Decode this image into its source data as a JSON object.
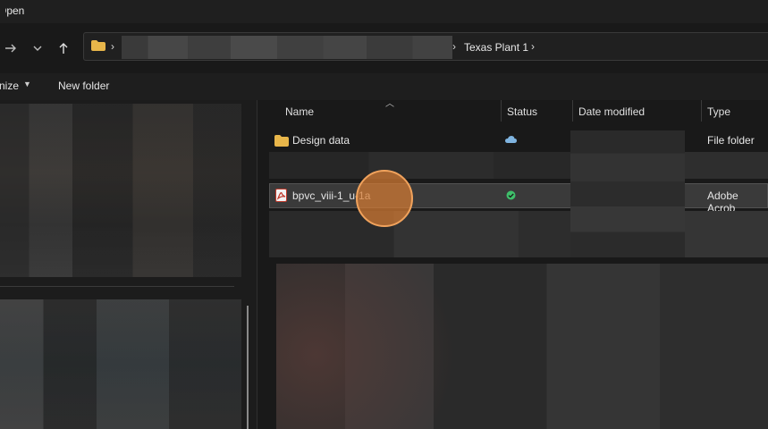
{
  "window": {
    "title": "Open"
  },
  "nav": {
    "back_icon": "arrow-left-icon",
    "forward_icon": "arrow-right-icon",
    "recent_icon": "chevron-down-icon",
    "up_icon": "arrow-up-icon"
  },
  "address": {
    "separator": "›",
    "current": "Texas Plant 1",
    "trailing_separator": "›"
  },
  "commands": {
    "organize_label": "nize",
    "new_folder_label": "New folder"
  },
  "columns": {
    "name": "Name",
    "status": "Status",
    "date_modified": "Date modified",
    "type": "Type"
  },
  "files": [
    {
      "name": "Design data",
      "status_icon": "cloud-icon",
      "type": "File folder",
      "icon": "folder-icon",
      "accent": "#e8b64a"
    },
    {
      "name": "bpvc_viii-1_u-1a",
      "status_icon": "check-circle-icon",
      "type": "Adobe Acrob",
      "icon": "pdf-icon",
      "accent": "#c0392b"
    }
  ],
  "colors": {
    "background": "#191919",
    "selected_row": "#3a3a3a",
    "click_marker": "#d67b33",
    "sync_ok": "#3fbf6a",
    "cloud": "#7fb4e0"
  }
}
